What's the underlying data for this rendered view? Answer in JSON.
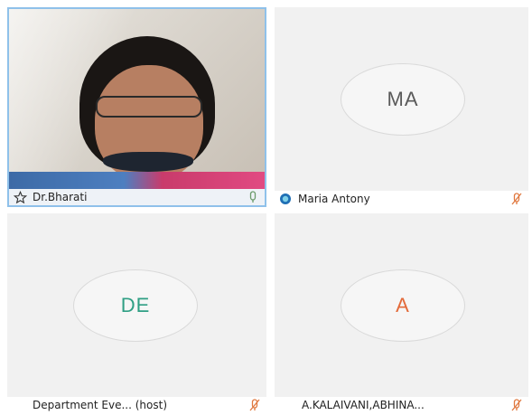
{
  "participants": [
    {
      "name": "Dr.Bharati",
      "type": "video",
      "mic": "on",
      "lead_icon": "pin-star-icon"
    },
    {
      "name": "Maria Antony",
      "initials": "MA",
      "type": "avatar",
      "mic": "muted",
      "lead_icon": "network-quality-icon",
      "initials_color": "#5a5a5a"
    },
    {
      "name": "Department Eve... (host)",
      "initials": "DE",
      "type": "avatar",
      "mic": "muted",
      "initials_color": "#2f9f84"
    },
    {
      "name": "A.KALAIVANI,ABHINA...",
      "initials": "A",
      "type": "avatar",
      "mic": "muted",
      "initials_color": "#e36a3a"
    }
  ],
  "colors": {
    "active_border": "#8fc1ea",
    "muted_icon": "#e0783f",
    "mic_on_icon": "#6a9a6a"
  }
}
